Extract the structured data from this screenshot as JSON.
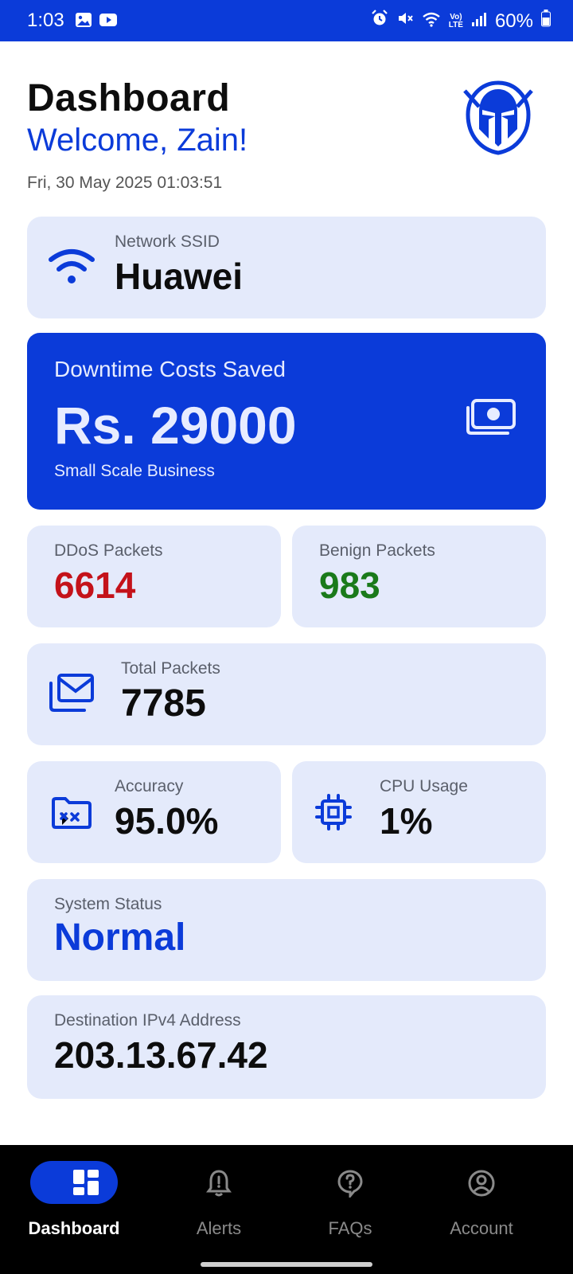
{
  "status_bar": {
    "time": "1:03",
    "battery": "60%",
    "network_type_top": "Vo)",
    "network_type_bottom": "LTE"
  },
  "header": {
    "title": "Dashboard",
    "welcome": "Welcome, Zain!",
    "datetime": "Fri, 30 May 2025  01:03:51"
  },
  "ssid_card": {
    "label": "Network SSID",
    "value": "Huawei"
  },
  "cost_card": {
    "label": "Downtime Costs Saved",
    "value": "Rs. 29000",
    "subtitle": "Small Scale Business"
  },
  "ddos_card": {
    "label": "DDoS Packets",
    "value": "6614",
    "color": "#c4121a"
  },
  "benign_card": {
    "label": "Benign Packets",
    "value": "983",
    "color": "#1a7a1a"
  },
  "total_card": {
    "label": "Total Packets",
    "value": "7785"
  },
  "accuracy_card": {
    "label": "Accuracy",
    "value": "95.0%"
  },
  "cpu_card": {
    "label": "CPU Usage",
    "value": "1%"
  },
  "status_card": {
    "label": "System Status",
    "value": "Normal",
    "color": "#0b3bd9"
  },
  "ip_card": {
    "label": "Destination IPv4 Address",
    "value": "203.13.67.42"
  },
  "nav": {
    "items": [
      {
        "label": "Dashboard",
        "icon": "dashboard-icon",
        "active": true
      },
      {
        "label": "Alerts",
        "icon": "bell-icon",
        "active": false
      },
      {
        "label": "FAQs",
        "icon": "help-icon",
        "active": false
      },
      {
        "label": "Account",
        "icon": "account-icon",
        "active": false
      }
    ]
  },
  "colors": {
    "accent": "#0b3bd9",
    "card_bg": "#e4eafb",
    "text": "#0d0d0d"
  }
}
